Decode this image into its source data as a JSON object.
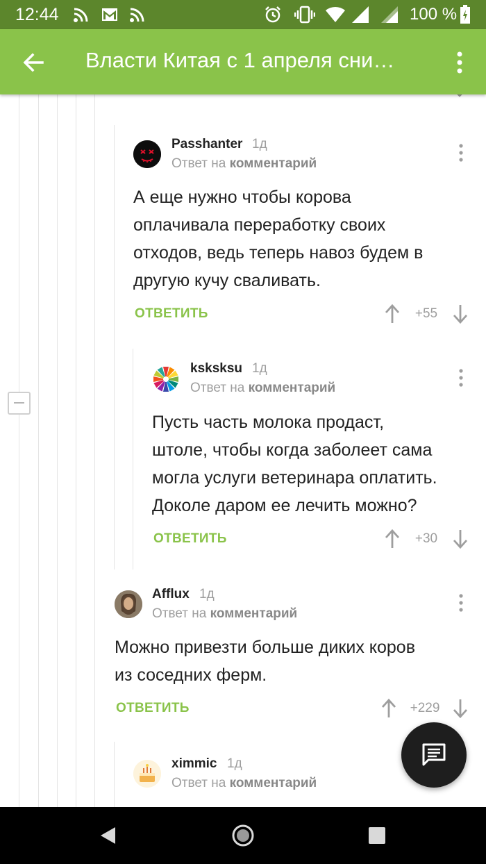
{
  "status_bar": {
    "time": "12:44",
    "battery": "100 %",
    "icons": [
      "rss-icon",
      "mail-icon",
      "rss-icon",
      "alarm-icon",
      "vibrate-icon",
      "wifi-icon",
      "signal-icon",
      "signal-icon",
      "battery-icon"
    ]
  },
  "app_bar": {
    "title": "Власти Китая с 1 апреля сни…",
    "back_icon": "arrow-left-icon",
    "menu_icon": "more-vert-icon"
  },
  "colors": {
    "accent": "#8ac34a",
    "status_bar": "#5c862c",
    "muted": "#9e9e9e"
  },
  "comments": [
    {
      "author": "Passhanter",
      "age": "1д",
      "reply_prefix": "Ответ на",
      "reply_target": "комментарий",
      "text_lines": [
        "А еще нужно чтобы корова",
        "оплачивала переработку своих",
        "отходов, ведь теперь навоз будем в",
        "другую кучу сваливать."
      ],
      "reply_label": "ОТВЕТИТЬ",
      "score": "+55"
    },
    {
      "author": "ksksksu",
      "age": "1д",
      "reply_prefix": "Ответ на",
      "reply_target": "комментарий",
      "text_lines": [
        "Пусть часть молока продаст,",
        "штоле, чтобы когда заболеет сама",
        "могла услуги ветеринара оплатить.",
        "Доколе даром ее лечить можно?"
      ],
      "reply_label": "ОТВЕТИТЬ",
      "score": "+30"
    },
    {
      "author": "Afflux",
      "age": "1д",
      "reply_prefix": "Ответ на",
      "reply_target": "комментарий",
      "text_lines": [
        "Можно привезти больше диких коров",
        "из соседних ферм."
      ],
      "reply_label": "ОТВЕТИТЬ",
      "score": "+229"
    },
    {
      "author": "ximmic",
      "age": "1д",
      "reply_prefix": "Ответ на",
      "reply_target": "комментарий"
    }
  ],
  "fab_icon": "comment-icon",
  "nav_bar": {
    "icons": [
      "back-triangle-icon",
      "home-circle-icon",
      "recents-square-icon"
    ]
  }
}
